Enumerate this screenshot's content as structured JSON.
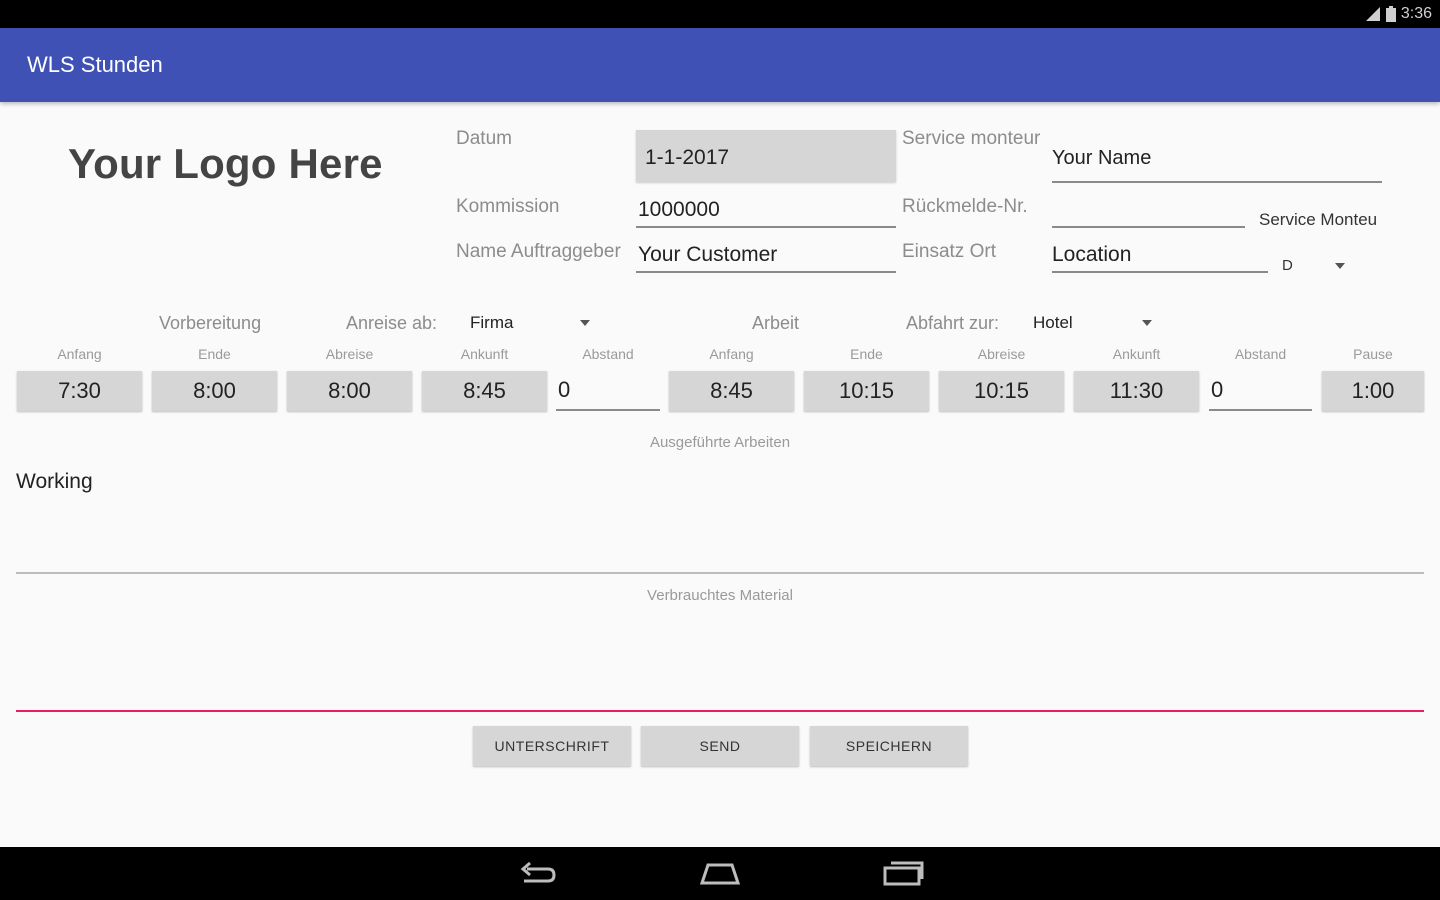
{
  "status_bar": {
    "time": "3:36",
    "signal_icon": "signal-icon",
    "battery_icon": "battery-icon"
  },
  "app_bar": {
    "title": "WLS Stunden",
    "color": "#3f51b5"
  },
  "logo": {
    "text": "Your Logo Here"
  },
  "form": {
    "datum_label": "Datum",
    "datum_value": "1-1-2017",
    "kommission_label": "Kommission",
    "kommission_value": "1000000",
    "auftraggeber_label": "Name Auftraggeber",
    "auftraggeber_value": "Your Customer",
    "monteur_label": "Service monteur",
    "monteur_value": "Your Name",
    "rueckmelde_label": "Rückmelde-Nr.",
    "rueckmelde_value": "",
    "service_monteur_hint": "Service Monteu",
    "einsatz_label": "Einsatz Ort",
    "einsatz_value": "Location",
    "country_value": "D"
  },
  "sections": {
    "vorbereitung": "Vorbereitung",
    "anreise_label": "Anreise ab:",
    "anreise_value": "Firma",
    "arbeit": "Arbeit",
    "abfahrt_label": "Abfahrt zur:",
    "abfahrt_value": "Hotel"
  },
  "time_columns": [
    {
      "label": "Anfang",
      "value": "7:30"
    },
    {
      "label": "Ende",
      "value": "8:00"
    },
    {
      "label": "Abreise",
      "value": "8:00"
    },
    {
      "label": "Ankunft",
      "value": "8:45"
    },
    {
      "label": "Abstand",
      "value": "0"
    },
    {
      "label": "Anfang",
      "value": "8:45"
    },
    {
      "label": "Ende",
      "value": "10:15"
    },
    {
      "label": "Abreise",
      "value": "10:15"
    },
    {
      "label": "Ankunft",
      "value": "11:30"
    },
    {
      "label": "Abstand",
      "value": "0"
    },
    {
      "label": "Pause",
      "value": "1:00"
    }
  ],
  "arbeiten": {
    "label": "Ausgeführte Arbeiten",
    "value": "Working"
  },
  "material": {
    "label": "Verbrauchtes Material",
    "value": "",
    "accent": "#e91e63"
  },
  "buttons": {
    "unterschrift": "UNTERSCHRIFT",
    "send": "SEND",
    "speichern": "SPEICHERN"
  },
  "nav_bar": {
    "back_icon": "back-icon",
    "home_icon": "home-icon",
    "recents_icon": "recents-icon"
  }
}
